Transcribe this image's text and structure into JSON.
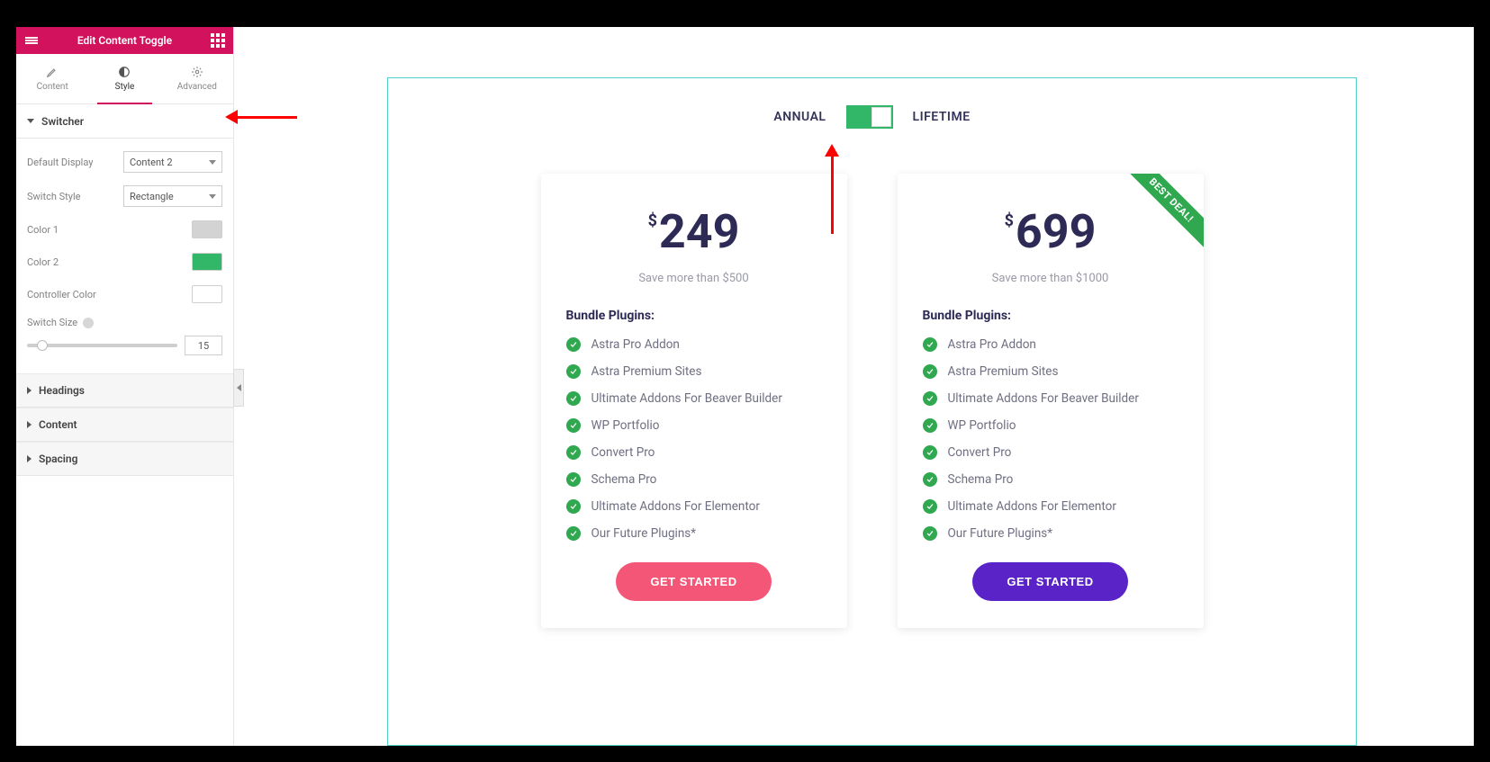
{
  "panel": {
    "title": "Edit Content Toggle",
    "tabs": {
      "content": "Content",
      "style": "Style",
      "advanced": "Advanced"
    },
    "sections": {
      "switcher": "Switcher",
      "headings": "Headings",
      "content": "Content",
      "spacing": "Spacing"
    },
    "controls": {
      "default_display_label": "Default Display",
      "default_display_value": "Content 2",
      "switch_style_label": "Switch Style",
      "switch_style_value": "Rectangle",
      "color1_label": "Color 1",
      "color1_value": "#d3d3d3",
      "color2_label": "Color 2",
      "color2_value": "#32b768",
      "controller_label": "Controller Color",
      "controller_value": "#ffffff",
      "switch_size_label": "Switch Size",
      "switch_size_value": "15"
    }
  },
  "toggle": {
    "left": "ANNUAL",
    "right": "LIFETIME"
  },
  "card_a": {
    "currency": "$",
    "price": "249",
    "subtitle": "Save more than $500",
    "features_title": "Bundle Plugins:",
    "cta": "GET STARTED",
    "features": [
      "Astra Pro Addon",
      "Astra Premium Sites",
      "Ultimate Addons For Beaver Builder",
      "WP Portfolio",
      "Convert Pro",
      "Schema Pro",
      "Ultimate Addons For Elementor",
      "Our Future Plugins*"
    ]
  },
  "card_b": {
    "ribbon": "BEST DEAL!",
    "currency": "$",
    "price": "699",
    "subtitle": "Save more than $1000",
    "features_title": "Bundle Plugins:",
    "cta": "GET STARTED",
    "features": [
      "Astra Pro Addon",
      "Astra Premium Sites",
      "Ultimate Addons For Beaver Builder",
      "WP Portfolio",
      "Convert Pro",
      "Schema Pro",
      "Ultimate Addons For Elementor",
      "Our Future Plugins*"
    ]
  }
}
